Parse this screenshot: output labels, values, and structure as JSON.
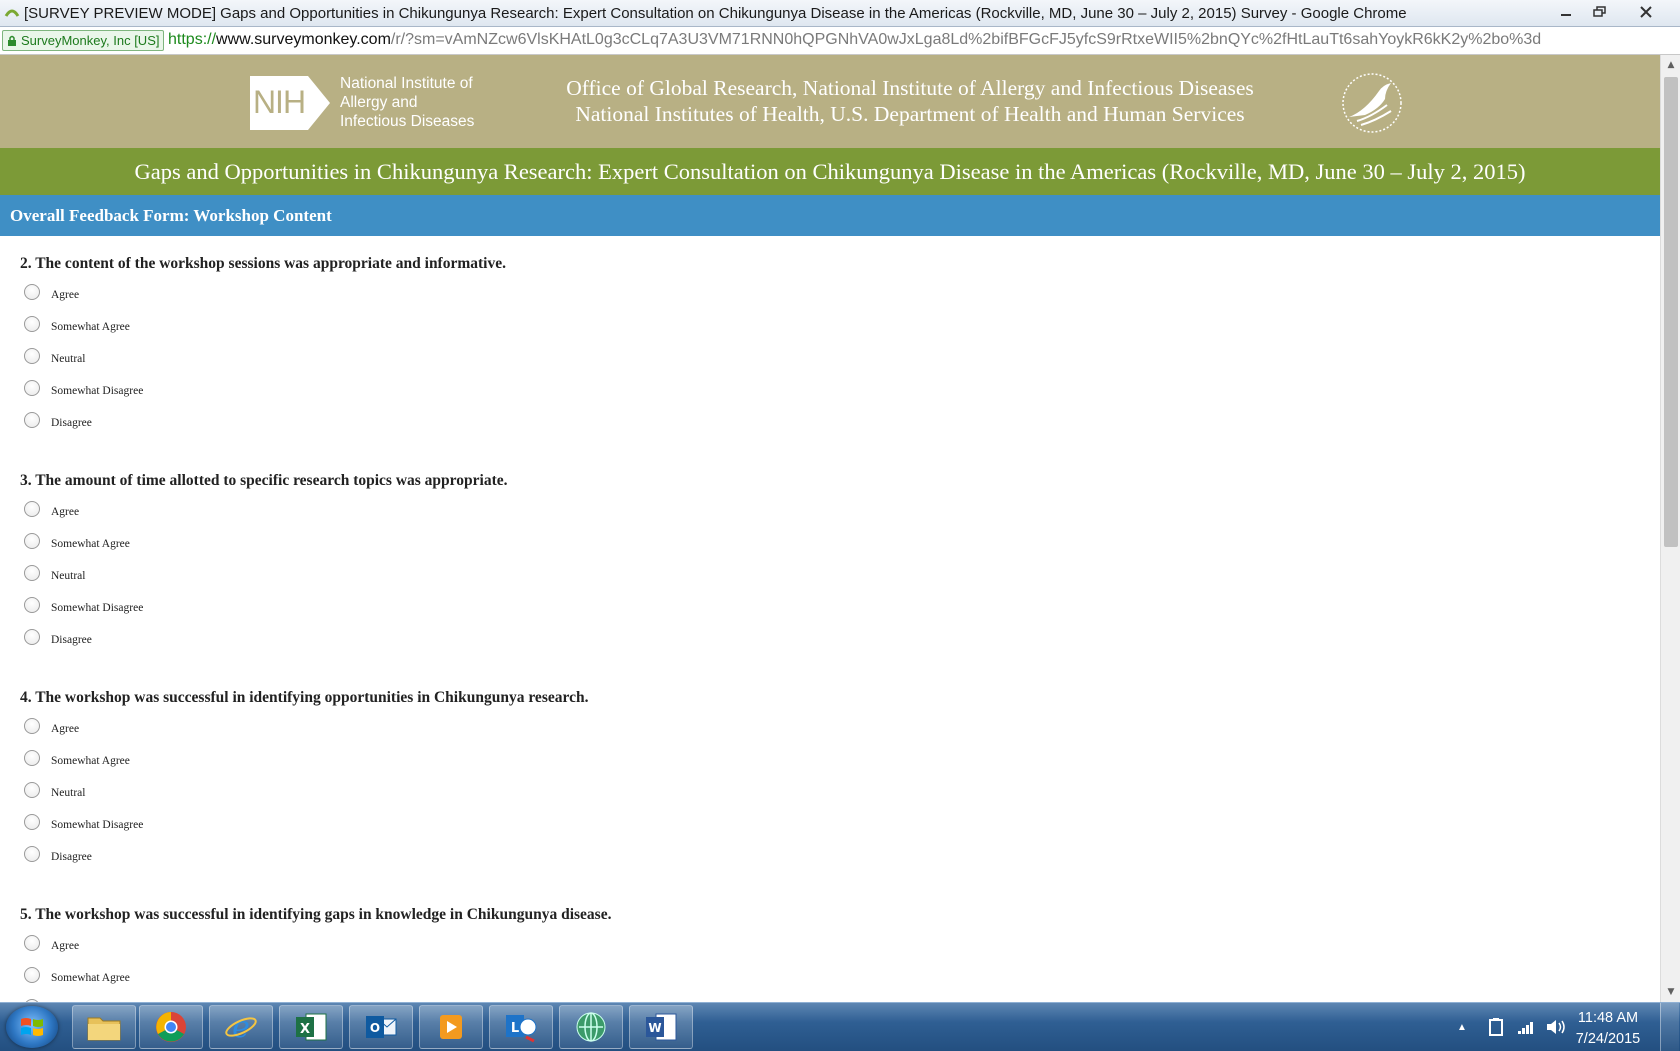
{
  "window": {
    "title": "[SURVEY PREVIEW MODE] Gaps and Opportunities in Chikungunya Research: Expert Consultation on Chikungunya Disease in the Americas (Rockville, MD, June 30 – July 2, 2015) Survey - Google Chrome"
  },
  "address_bar": {
    "site_badge": "SurveyMonkey, Inc [US]",
    "url_scheme": "https://",
    "url_host": "www.surveymonkey.com",
    "url_path": "/r/?sm=vAmNZcw6VlsKHAtL0g3cCLq7A3U3VM71RNN0hQPGNhVA0wJxLga8Ld%2bifBFGcFJ5yfcS9rRtxeWII5%2bnQYc%2fHtLauTt6sahYoykR6kK2y%2bo%3d"
  },
  "header": {
    "nih_mark": "NIH",
    "nih_text_lines": [
      "National Institute of",
      "Allergy and",
      "Infectious Diseases"
    ],
    "office_line1": "Office of Global Research, National Institute of Allergy and Infectious Diseases",
    "office_line2": "National Institutes of Health, U.S. Department of Health and Human Services",
    "seal_label": "hhs-seal"
  },
  "survey": {
    "title": "Gaps and Opportunities in Chikungunya Research: Expert Consultation on Chikungunya Disease in the Americas (Rockville, MD, June 30 – July 2, 2015)",
    "section": "Overall Feedback Form: Workshop Content",
    "questions": [
      {
        "label": "2. The content of the workshop sessions was appropriate and informative.",
        "options": [
          "Agree",
          "Somewhat Agree",
          "Neutral",
          "Somewhat Disagree",
          "Disagree"
        ]
      },
      {
        "label": "3. The amount of time allotted to specific research topics was appropriate.",
        "options": [
          "Agree",
          "Somewhat Agree",
          "Neutral",
          "Somewhat Disagree",
          "Disagree"
        ]
      },
      {
        "label": "4. The workshop was successful in identifying opportunities in Chikungunya research.",
        "options": [
          "Agree",
          "Somewhat Agree",
          "Neutral",
          "Somewhat Disagree",
          "Disagree"
        ]
      },
      {
        "label": "5. The workshop was successful in identifying gaps in knowledge in Chikungunya disease.",
        "options": [
          "Agree",
          "Somewhat Agree"
        ]
      }
    ]
  },
  "taskbar": {
    "apps": [
      "file-explorer",
      "google-chrome",
      "internet-explorer",
      "microsoft-excel",
      "microsoft-outlook",
      "media-player",
      "microsoft-lync",
      "network-app",
      "microsoft-word"
    ],
    "clock_time": "11:48 AM",
    "clock_date": "7/24/2015"
  },
  "colors": {
    "header_tan": "#b8b084",
    "title_green": "#7c9a37",
    "section_blue": "#3f8fc5"
  }
}
